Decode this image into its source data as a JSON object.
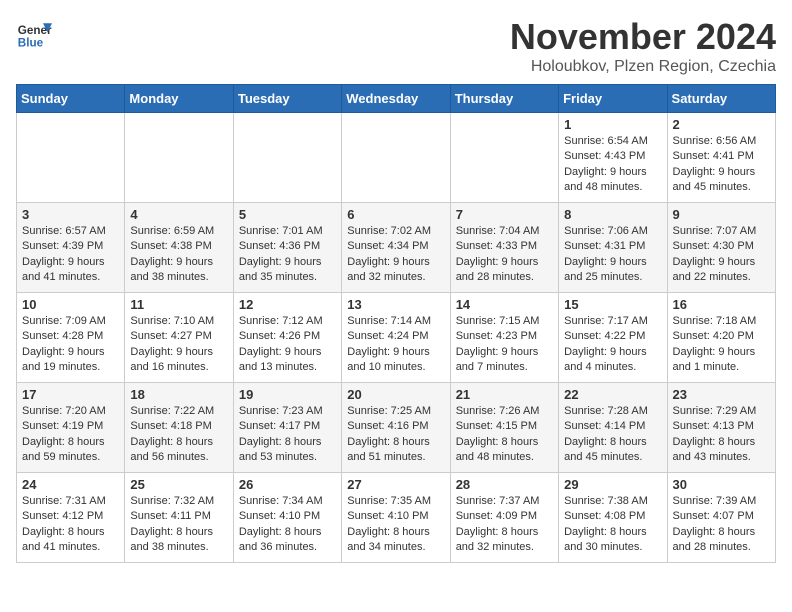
{
  "header": {
    "logo_line1": "General",
    "logo_line2": "Blue",
    "title": "November 2024",
    "subtitle": "Holoubkov, Plzen Region, Czechia"
  },
  "days_of_week": [
    "Sunday",
    "Monday",
    "Tuesday",
    "Wednesday",
    "Thursday",
    "Friday",
    "Saturday"
  ],
  "weeks": [
    [
      {
        "day": "",
        "info": ""
      },
      {
        "day": "",
        "info": ""
      },
      {
        "day": "",
        "info": ""
      },
      {
        "day": "",
        "info": ""
      },
      {
        "day": "",
        "info": ""
      },
      {
        "day": "1",
        "info": "Sunrise: 6:54 AM\nSunset: 4:43 PM\nDaylight: 9 hours\nand 48 minutes."
      },
      {
        "day": "2",
        "info": "Sunrise: 6:56 AM\nSunset: 4:41 PM\nDaylight: 9 hours\nand 45 minutes."
      }
    ],
    [
      {
        "day": "3",
        "info": "Sunrise: 6:57 AM\nSunset: 4:39 PM\nDaylight: 9 hours\nand 41 minutes."
      },
      {
        "day": "4",
        "info": "Sunrise: 6:59 AM\nSunset: 4:38 PM\nDaylight: 9 hours\nand 38 minutes."
      },
      {
        "day": "5",
        "info": "Sunrise: 7:01 AM\nSunset: 4:36 PM\nDaylight: 9 hours\nand 35 minutes."
      },
      {
        "day": "6",
        "info": "Sunrise: 7:02 AM\nSunset: 4:34 PM\nDaylight: 9 hours\nand 32 minutes."
      },
      {
        "day": "7",
        "info": "Sunrise: 7:04 AM\nSunset: 4:33 PM\nDaylight: 9 hours\nand 28 minutes."
      },
      {
        "day": "8",
        "info": "Sunrise: 7:06 AM\nSunset: 4:31 PM\nDaylight: 9 hours\nand 25 minutes."
      },
      {
        "day": "9",
        "info": "Sunrise: 7:07 AM\nSunset: 4:30 PM\nDaylight: 9 hours\nand 22 minutes."
      }
    ],
    [
      {
        "day": "10",
        "info": "Sunrise: 7:09 AM\nSunset: 4:28 PM\nDaylight: 9 hours\nand 19 minutes."
      },
      {
        "day": "11",
        "info": "Sunrise: 7:10 AM\nSunset: 4:27 PM\nDaylight: 9 hours\nand 16 minutes."
      },
      {
        "day": "12",
        "info": "Sunrise: 7:12 AM\nSunset: 4:26 PM\nDaylight: 9 hours\nand 13 minutes."
      },
      {
        "day": "13",
        "info": "Sunrise: 7:14 AM\nSunset: 4:24 PM\nDaylight: 9 hours\nand 10 minutes."
      },
      {
        "day": "14",
        "info": "Sunrise: 7:15 AM\nSunset: 4:23 PM\nDaylight: 9 hours\nand 7 minutes."
      },
      {
        "day": "15",
        "info": "Sunrise: 7:17 AM\nSunset: 4:22 PM\nDaylight: 9 hours\nand 4 minutes."
      },
      {
        "day": "16",
        "info": "Sunrise: 7:18 AM\nSunset: 4:20 PM\nDaylight: 9 hours\nand 1 minute."
      }
    ],
    [
      {
        "day": "17",
        "info": "Sunrise: 7:20 AM\nSunset: 4:19 PM\nDaylight: 8 hours\nand 59 minutes."
      },
      {
        "day": "18",
        "info": "Sunrise: 7:22 AM\nSunset: 4:18 PM\nDaylight: 8 hours\nand 56 minutes."
      },
      {
        "day": "19",
        "info": "Sunrise: 7:23 AM\nSunset: 4:17 PM\nDaylight: 8 hours\nand 53 minutes."
      },
      {
        "day": "20",
        "info": "Sunrise: 7:25 AM\nSunset: 4:16 PM\nDaylight: 8 hours\nand 51 minutes."
      },
      {
        "day": "21",
        "info": "Sunrise: 7:26 AM\nSunset: 4:15 PM\nDaylight: 8 hours\nand 48 minutes."
      },
      {
        "day": "22",
        "info": "Sunrise: 7:28 AM\nSunset: 4:14 PM\nDaylight: 8 hours\nand 45 minutes."
      },
      {
        "day": "23",
        "info": "Sunrise: 7:29 AM\nSunset: 4:13 PM\nDaylight: 8 hours\nand 43 minutes."
      }
    ],
    [
      {
        "day": "24",
        "info": "Sunrise: 7:31 AM\nSunset: 4:12 PM\nDaylight: 8 hours\nand 41 minutes."
      },
      {
        "day": "25",
        "info": "Sunrise: 7:32 AM\nSunset: 4:11 PM\nDaylight: 8 hours\nand 38 minutes."
      },
      {
        "day": "26",
        "info": "Sunrise: 7:34 AM\nSunset: 4:10 PM\nDaylight: 8 hours\nand 36 minutes."
      },
      {
        "day": "27",
        "info": "Sunrise: 7:35 AM\nSunset: 4:10 PM\nDaylight: 8 hours\nand 34 minutes."
      },
      {
        "day": "28",
        "info": "Sunrise: 7:37 AM\nSunset: 4:09 PM\nDaylight: 8 hours\nand 32 minutes."
      },
      {
        "day": "29",
        "info": "Sunrise: 7:38 AM\nSunset: 4:08 PM\nDaylight: 8 hours\nand 30 minutes."
      },
      {
        "day": "30",
        "info": "Sunrise: 7:39 AM\nSunset: 4:07 PM\nDaylight: 8 hours\nand 28 minutes."
      }
    ]
  ]
}
